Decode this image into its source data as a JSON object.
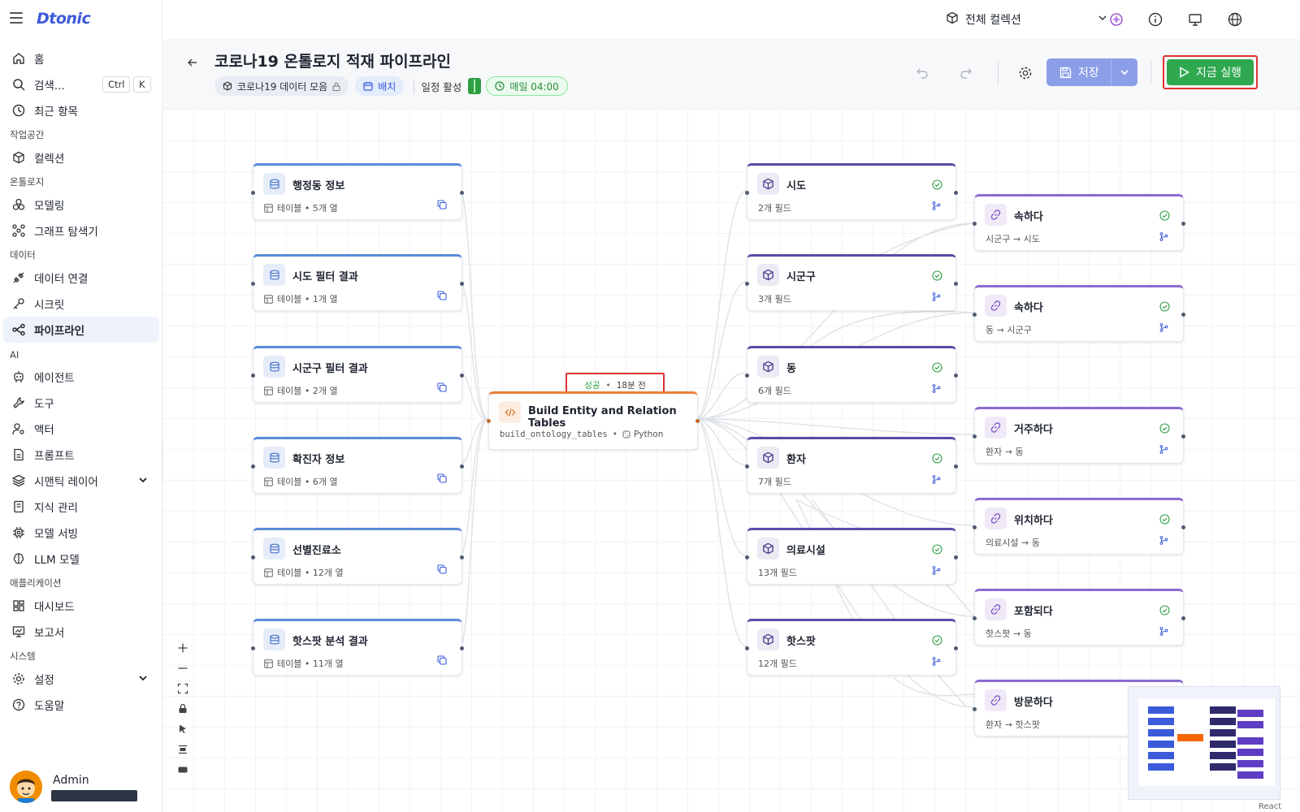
{
  "brand": "Dtonic",
  "sidebar": {
    "home": "홈",
    "search": "검색...",
    "shortcut_ctrl": "Ctrl",
    "shortcut_k": "K",
    "recent": "최근 항목",
    "sections": {
      "workspace": "작업공간",
      "ontology": "온톨로지",
      "data": "데이터",
      "ai": "AI",
      "apps": "애플리케이션",
      "system": "시스템"
    },
    "items": {
      "collection": "컬렉션",
      "modeling": "모델링",
      "graph": "그래프 탐색기",
      "data_conn": "데이터 연결",
      "secret": "시크릿",
      "pipeline": "파이프라인",
      "agent": "에이전트",
      "tool": "도구",
      "actor": "액터",
      "prompt": "프롬프트",
      "semantic": "시맨틱 레이어",
      "knowledge": "지식 관리",
      "model_serving": "모델 서빙",
      "llm": "LLM 모델",
      "dashboard": "대시보드",
      "report": "보고서",
      "settings": "설정",
      "help": "도움말"
    },
    "user": "Admin"
  },
  "topbar": {
    "collection": "전체 컬렉션"
  },
  "header": {
    "title": "코로나19 온톨로지 적재 파이프라인",
    "collection_tag": "코로나19 데이터 모음",
    "batch_tag": "배치",
    "schedule_label": "일정 활성",
    "schedule_time": "매일 04:00",
    "save": "저장",
    "run": "지금 실행"
  },
  "sources": [
    {
      "title": "행정동 정보",
      "sub": "테이블 • 5개 열"
    },
    {
      "title": "시도 필터 결과",
      "sub": "테이블 • 1개 열"
    },
    {
      "title": "시군구 필터 결과",
      "sub": "테이블 • 2개 열"
    },
    {
      "title": "확진자 정보",
      "sub": "테이블 • 6개 열"
    },
    {
      "title": "선별진료소",
      "sub": "테이블 • 12개 열"
    },
    {
      "title": "핫스팟 분석 결과",
      "sub": "테이블 • 11개 열"
    }
  ],
  "transform": {
    "title": "Build Entity and Relation Tables",
    "func": "build_ontology_tables",
    "lang": "Python",
    "status": "성공",
    "ago": "18분 전"
  },
  "entities": [
    {
      "title": "시도",
      "sub": "2개 필드"
    },
    {
      "title": "시군구",
      "sub": "3개 필드"
    },
    {
      "title": "동",
      "sub": "6개 필드"
    },
    {
      "title": "환자",
      "sub": "7개 필드"
    },
    {
      "title": "의료시설",
      "sub": "13개 필드"
    },
    {
      "title": "핫스팟",
      "sub": "12개 필드"
    }
  ],
  "relations": [
    {
      "title": "속하다",
      "sub": "시군구 → 시도"
    },
    {
      "title": "속하다",
      "sub": "동 → 시군구"
    },
    {
      "title": "거주하다",
      "sub": "환자 → 동"
    },
    {
      "title": "위치하다",
      "sub": "의료시설 → 동"
    },
    {
      "title": "포함되다",
      "sub": "핫스팟 → 동"
    },
    {
      "title": "방문하다",
      "sub": "환자 → 핫스팟"
    }
  ],
  "footer": {
    "attribution": "React Flow"
  },
  "colors": {
    "accent": "#3b5bdb",
    "run": "#2fa84f",
    "success": "#2f9e44",
    "entity": "#5a4ba8",
    "transform": "#e8833a"
  }
}
